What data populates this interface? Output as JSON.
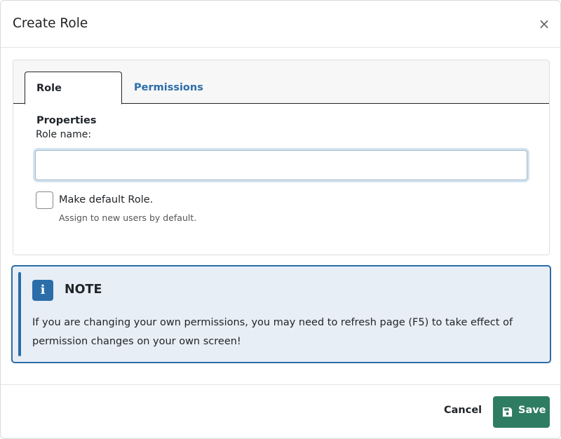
{
  "dialog": {
    "title": "Create Role",
    "close_glyph": "×"
  },
  "tabs": [
    {
      "label": "Role Properties",
      "active": true
    },
    {
      "label": "Permissions",
      "active": false
    }
  ],
  "form": {
    "role_name_label": "Role name:",
    "role_name_value": "",
    "role_name_placeholder": "",
    "default_checkbox_label": "Make default Role.",
    "default_checkbox_checked": false,
    "default_checkbox_help": "Assign to new users by default."
  },
  "note": {
    "icon": "info-icon",
    "icon_glyph": "i",
    "title": "NOTE",
    "text": "If you are changing your own permissions, you may need to refresh page (F5) to take effect of permission changes on your own screen!"
  },
  "footer": {
    "cancel_label": "Cancel",
    "save_label": "Save",
    "save_icon": "floppy-disk-icon"
  },
  "colors": {
    "accent": "#2b6da8",
    "save": "#2e7d62",
    "note_bg": "#e8eef6"
  }
}
